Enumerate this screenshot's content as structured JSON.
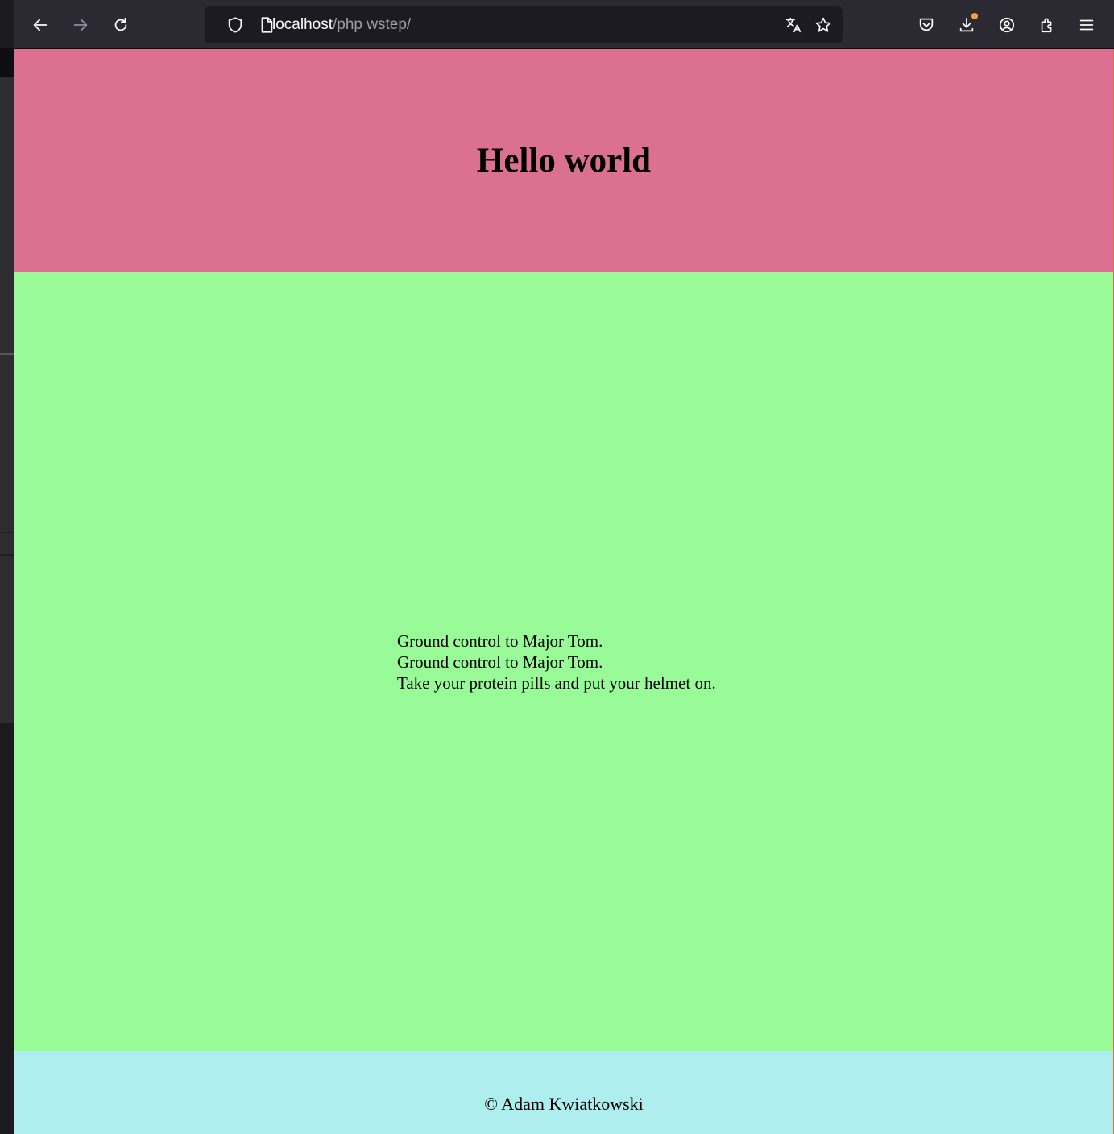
{
  "browser": {
    "url_host": "localhost",
    "url_path": "/php wstep/",
    "icons": {
      "back": "arrow-left-icon",
      "forward": "arrow-right-icon",
      "reload": "reload-icon",
      "tracking": "shield-icon",
      "page": "page-icon",
      "translate": "translate-icon",
      "bookmark": "star-icon",
      "pocket": "pocket-icon",
      "downloads": "download-icon",
      "account": "account-icon",
      "extensions": "extensions-icon",
      "menu": "hamburger-menu-icon"
    },
    "colors": {
      "toolbar": "#2b2a33",
      "urlbar": "#1c1b22",
      "download_badge": "#f3a33b"
    }
  },
  "page": {
    "heading": "Hello world",
    "lyrics": [
      "Ground control to Major Tom.",
      "Ground control to Major Tom.",
      "Take your protein pills and put your helmet on."
    ],
    "footer": "© Adam Kwiatkowski",
    "colors": {
      "header_bg": "#db7093",
      "main_bg": "#98fb98",
      "footer_bg": "#afeeee"
    }
  }
}
